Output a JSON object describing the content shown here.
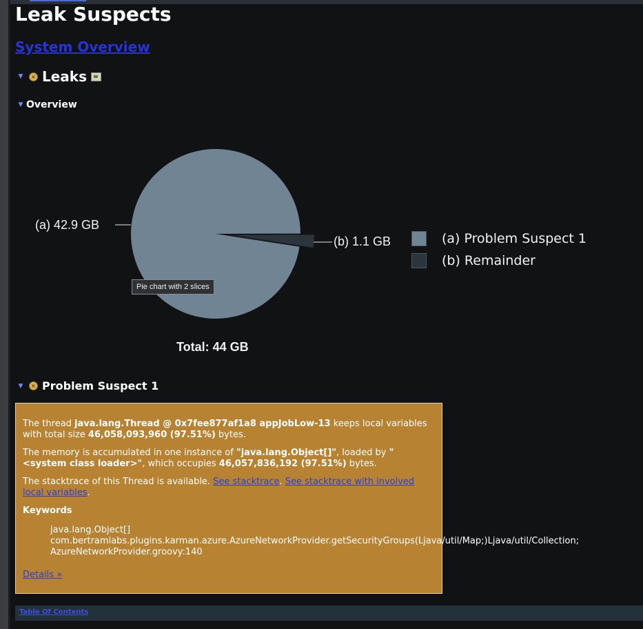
{
  "page": {
    "title": "Leak Suspects",
    "system_overview_link": "System Overview",
    "toc_link": "Table Of Contents"
  },
  "leaks_section": {
    "title": "Leaks",
    "icons": [
      "x-icon",
      "image-icon"
    ]
  },
  "overview_section": {
    "title": "Overview"
  },
  "colors": {
    "background": "#111214",
    "slice_a": "#708494",
    "slice_b": "#2c343c",
    "suspect_box": "#b88233",
    "link": "#2833d6"
  },
  "chart_data": {
    "type": "pie",
    "slices": [
      {
        "label": "(a)  42.9 GB",
        "value": 42.9,
        "legend": "(a)  Problem Suspect 1"
      },
      {
        "label": "(b)  1.1 GB",
        "value": 1.1,
        "legend": "(b)  Remainder"
      }
    ],
    "total": "Total: 44 GB",
    "tooltip": "Pie chart with 2 slices",
    "legend_position": "right"
  },
  "suspect": {
    "title": "Problem Suspect 1",
    "p1_a": "The thread ",
    "p1_thread": "java.lang.Thread @ 0x7fee877af1a8 appJobLow-13",
    "p1_b": " keeps local variables with total size ",
    "p1_size": "46,058,093,960 (97.51%)",
    "p1_c": " bytes.",
    "p2_a": "The memory is accumulated in one instance of ",
    "p2_class": "\"java.lang.Object[]\"",
    "p2_b": ", loaded by ",
    "p2_loader": "\"<system class loader>\"",
    "p2_c": ", which occupies ",
    "p2_size": "46,057,836,192 (97.51%)",
    "p2_d": " bytes.",
    "p3_a": "The stacktrace of this Thread is available. ",
    "p3_link1": "See stacktrace",
    "p3_b": ". ",
    "p3_link2": "See stacktrace with involved local variables",
    "p3_c": ".",
    "keywords_title": "Keywords",
    "keywords": [
      "java.lang.Object[]",
      "com.bertramlabs.plugins.karman.azure.AzureNetworkProvider.getSecurityGroups(Ljava/util/Map;)Ljava/util/Collection;",
      "AzureNetworkProvider.groovy:140"
    ],
    "details_link": "Details »"
  }
}
